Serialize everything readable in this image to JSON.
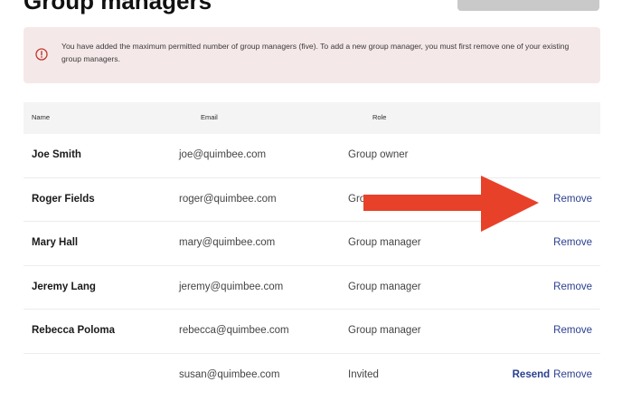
{
  "page": {
    "title": "Group managers",
    "top_button_label": ""
  },
  "alert": {
    "text": "You have added the maximum permitted number of group managers (five). To add a new group manager, you must first remove one of your existing group managers.",
    "icon": "alert-circle-icon",
    "color": "#f5e8e9"
  },
  "table": {
    "headers": {
      "name": "Name",
      "email": "Email",
      "role": "Role"
    },
    "rows": [
      {
        "name": "Joe Smith",
        "email": "joe@quimbee.com",
        "role": "Group owner",
        "actions": []
      },
      {
        "name": "Roger Fields",
        "email": "roger@quimbee.com",
        "role": "Group manager",
        "actions": [
          "Remove"
        ]
      },
      {
        "name": "Mary Hall",
        "email": "mary@quimbee.com",
        "role": "Group manager",
        "actions": [
          "Remove"
        ]
      },
      {
        "name": "Jeremy Lang",
        "email": "jeremy@quimbee.com",
        "role": "Group manager",
        "actions": [
          "Remove"
        ]
      },
      {
        "name": "Rebecca Poloma",
        "email": "rebecca@quimbee.com",
        "role": "Group manager",
        "actions": [
          "Remove"
        ]
      },
      {
        "name": "",
        "email": "susan@quimbee.com",
        "role": "Invited",
        "actions": [
          "Resend",
          "Remove"
        ]
      }
    ]
  },
  "annotation": {
    "icon": "red-arrow-icon",
    "color": "#e8412a"
  },
  "colors": {
    "link": "#2a3f8f",
    "header_bg": "#f4f4f4"
  }
}
